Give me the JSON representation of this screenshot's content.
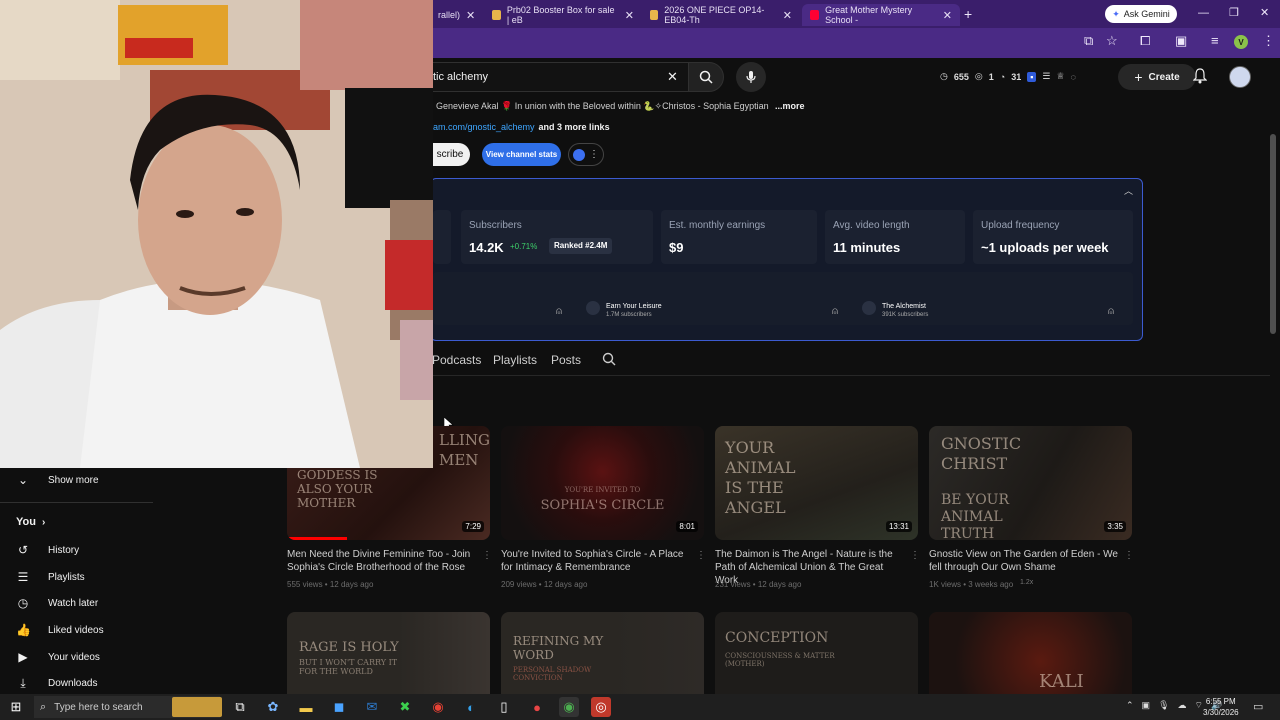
{
  "browser": {
    "tabs": [
      {
        "label": "rallel)",
        "active": false
      },
      {
        "label": "Prb02 Booster Box for sale | eB",
        "active": false
      },
      {
        "label": "2026 ONE PIECE OP14-EB04-Th",
        "active": false
      },
      {
        "label": "Great Mother Mystery School -",
        "active": true
      }
    ],
    "ask_gemini": "Ask Gemini",
    "profile_initial": "V"
  },
  "header": {
    "search_value": "tic alchemy",
    "ext_counts": {
      "views": "655",
      "a": "1",
      "b": "31"
    },
    "create_label": "Create"
  },
  "channel": {
    "description": "Genevieve Akal 🌹 In union with the Beloved within 🐍✧Christos - Sophia Egyptian",
    "more_label": "...more",
    "link_text": "am.com/gnostic_alchemy",
    "more_links": "and 3 more links",
    "subscribe_label": "scribe",
    "view_stats_label": "View channel stats"
  },
  "stats": {
    "subscribers_label": "Subscribers",
    "subscribers_value": "14.2K",
    "subscribers_delta": "+0.71%",
    "rank": "Ranked #2.4M",
    "earnings_label": "Est. monthly earnings",
    "earnings_value": "$9",
    "length_label": "Avg. video length",
    "length_value": "11 minutes",
    "frequency_label": "Upload frequency",
    "frequency_value": "~1 uploads per week",
    "similar": [
      {
        "name": "Earn Your Leisure",
        "subs": "1.7M subscribers"
      },
      {
        "name": "The Alchemist",
        "subs": "391K subscribers"
      }
    ]
  },
  "tabs": [
    "Podcasts",
    "Playlists",
    "Posts"
  ],
  "videos_row1": [
    {
      "title": "Men Need the Divine Feminine Too - Join Sophia's Circle Brotherhood of the Rose",
      "meta": "555 views • 12 days ago",
      "duration": "7:29",
      "thumb_text": "GODDESS IS ALSO YOUR MOTHER",
      "thumb_top": "LLING MEN"
    },
    {
      "title": "You're Invited to Sophia's Circle - A Place for Intimacy & Remembrance",
      "meta": "209 views • 12 days ago",
      "duration": "8:01",
      "thumb_text": "SOPHIA'S CIRCLE",
      "thumb_top": "YOU'RE INVITED TO"
    },
    {
      "title": "The Daimon is The Angel - Nature is the Path of Alchemical Union & The Great Work",
      "meta": "231 views • 12 days ago",
      "duration": "13:31",
      "thumb_text": "YOUR ANIMAL IS THE ANGEL",
      "thumb_top": ""
    },
    {
      "title": "Gnostic View on The Garden of Eden - We fell through Our Own Shame",
      "meta": "1K views • 3 weeks ago",
      "duration": "3:35",
      "thumb_text": "GNOSTIC CHRIST",
      "thumb_top": "BE YOUR ANIMAL TRUTH",
      "badge": "1.2x"
    }
  ],
  "videos_row2": [
    {
      "thumb_text": "RAGE IS HOLY",
      "sub": "BUT I WON'T CARRY IT FOR THE WORLD"
    },
    {
      "thumb_text": "REFINING MY WORD",
      "sub": "PERSONAL SHADOW CONVICTION"
    },
    {
      "thumb_text": "CONCEPTION",
      "sub": "CONSCIOUSNESS & MATTER (MOTHER)"
    },
    {
      "thumb_text": "KALI",
      "sub": ""
    }
  ],
  "sidebar": {
    "show_more": "Show more",
    "you_label": "You",
    "items": [
      "History",
      "Playlists",
      "Watch later",
      "Liked videos",
      "Your videos",
      "Downloads"
    ]
  },
  "taskbar": {
    "search_placeholder": "Type here to search",
    "time": "6:55 PM",
    "date": "3/30/2026"
  }
}
